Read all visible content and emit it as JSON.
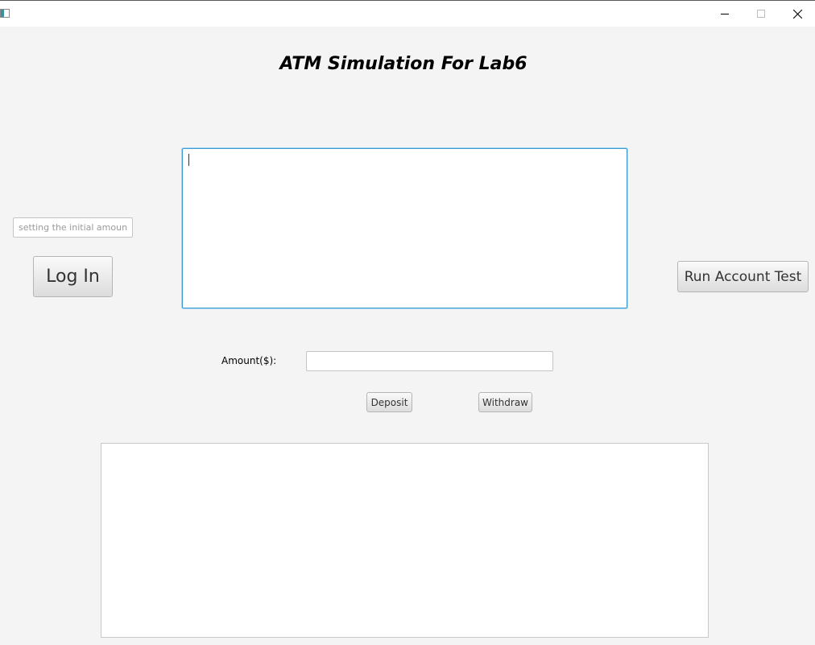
{
  "window": {
    "title": "",
    "controls": {
      "minimize_icon": "minimize-icon",
      "maximize_icon": "maximize-icon",
      "close_icon": "close-icon"
    }
  },
  "heading": "ATM Simulation For Lab6",
  "login": {
    "initial_amount_placeholder": "setting the initial amount",
    "initial_amount_value": "",
    "login_label": "Log In"
  },
  "display": {
    "text": ""
  },
  "run_test_label": "Run Account Test",
  "transaction": {
    "amount_label": "Amount($):",
    "amount_value": "",
    "deposit_label": "Deposit",
    "withdraw_label": "Withdraw"
  },
  "log": {
    "text": ""
  },
  "colors": {
    "background": "#f4f4f4",
    "focus_border": "#3a9bd5",
    "button_gradient_top": "#fafafa",
    "button_gradient_bottom": "#dcdcdc"
  }
}
